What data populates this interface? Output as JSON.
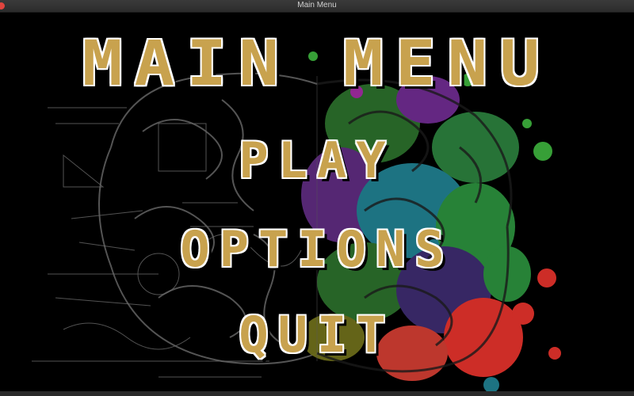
{
  "window": {
    "title": "Main Menu"
  },
  "menu": {
    "title": "MAIN MENU",
    "items": [
      {
        "label": "PLAY"
      },
      {
        "label": "OPTIONS"
      },
      {
        "label": "QUIT"
      }
    ]
  },
  "colors": {
    "text_fill": "#c8a24e",
    "text_outline": "#ffffff",
    "background": "#000000"
  }
}
